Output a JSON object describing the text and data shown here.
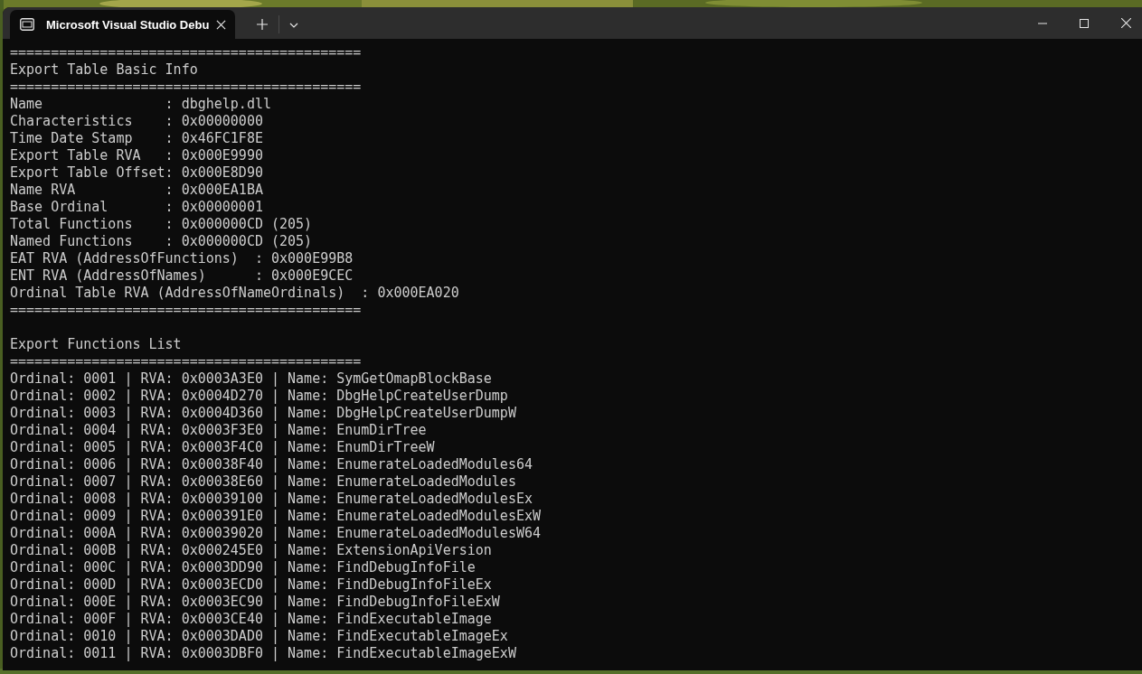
{
  "window": {
    "tabs": [
      {
        "title": "Microsoft Visual Studio Debu",
        "selected": true
      }
    ]
  },
  "console": {
    "lines": [
      {
        "kind": "text",
        "text": "==========================================="
      },
      {
        "kind": "text",
        "text": "Export Table Basic Info"
      },
      {
        "kind": "text",
        "text": "==========================================="
      },
      {
        "kind": "text",
        "text": "Name               : dbghelp.dll"
      },
      {
        "kind": "text",
        "text": "Characteristics    : 0x00000000"
      },
      {
        "kind": "text",
        "text": "Time Date Stamp    : 0x46FC1F8E"
      },
      {
        "kind": "text",
        "text": "Export Table RVA   : 0x000E9990"
      },
      {
        "kind": "text",
        "text": "Export Table Offset: 0x000E8D90"
      },
      {
        "kind": "text",
        "text": "Name RVA           : 0x000EA1BA"
      },
      {
        "kind": "text",
        "text": "Base Ordinal       : 0x00000001"
      },
      {
        "kind": "text",
        "text": "Total Functions    : 0x000000CD (205)"
      },
      {
        "kind": "text",
        "text": "Named Functions    : 0x000000CD (205)"
      },
      {
        "kind": "text",
        "text": "EAT RVA (AddressOfFunctions)  : 0x000E99B8"
      },
      {
        "kind": "text",
        "text": "ENT RVA (AddressOfNames)      : 0x000E9CEC"
      },
      {
        "kind": "text",
        "text": "Ordinal Table RVA (AddressOfNameOrdinals)  : 0x000EA020"
      },
      {
        "kind": "text",
        "text": "==========================================="
      },
      {
        "kind": "blank"
      },
      {
        "kind": "text",
        "text": "Export Functions List"
      },
      {
        "kind": "text",
        "text": "==========================================="
      },
      {
        "kind": "text",
        "text": "Ordinal: 0001 | RVA: 0x0003A3E0 | Name: SymGetOmapBlockBase"
      },
      {
        "kind": "text",
        "text": "Ordinal: 0002 | RVA: 0x0004D270 | Name: DbgHelpCreateUserDump"
      },
      {
        "kind": "text",
        "text": "Ordinal: 0003 | RVA: 0x0004D360 | Name: DbgHelpCreateUserDumpW"
      },
      {
        "kind": "text",
        "text": "Ordinal: 0004 | RVA: 0x0003F3E0 | Name: EnumDirTree"
      },
      {
        "kind": "text",
        "text": "Ordinal: 0005 | RVA: 0x0003F4C0 | Name: EnumDirTreeW"
      },
      {
        "kind": "text",
        "text": "Ordinal: 0006 | RVA: 0x00038F40 | Name: EnumerateLoadedModules64"
      },
      {
        "kind": "text",
        "text": "Ordinal: 0007 | RVA: 0x00038E60 | Name: EnumerateLoadedModules"
      },
      {
        "kind": "text",
        "text": "Ordinal: 0008 | RVA: 0x00039100 | Name: EnumerateLoadedModulesEx"
      },
      {
        "kind": "text",
        "text": "Ordinal: 0009 | RVA: 0x000391E0 | Name: EnumerateLoadedModulesExW"
      },
      {
        "kind": "text",
        "text": "Ordinal: 000A | RVA: 0x00039020 | Name: EnumerateLoadedModulesW64"
      },
      {
        "kind": "text",
        "text": "Ordinal: 000B | RVA: 0x000245E0 | Name: ExtensionApiVersion"
      },
      {
        "kind": "text",
        "text": "Ordinal: 000C | RVA: 0x0003DD90 | Name: FindDebugInfoFile"
      },
      {
        "kind": "text",
        "text": "Ordinal: 000D | RVA: 0x0003ECD0 | Name: FindDebugInfoFileEx"
      },
      {
        "kind": "text",
        "text": "Ordinal: 000E | RVA: 0x0003EC90 | Name: FindDebugInfoFileExW"
      },
      {
        "kind": "text",
        "text": "Ordinal: 000F | RVA: 0x0003CE40 | Name: FindExecutableImage"
      },
      {
        "kind": "text",
        "text": "Ordinal: 0010 | RVA: 0x0003DAD0 | Name: FindExecutableImageEx"
      },
      {
        "kind": "text",
        "text": "Ordinal: 0011 | RVA: 0x0003DBF0 | Name: FindExecutableImageExW"
      }
    ]
  }
}
